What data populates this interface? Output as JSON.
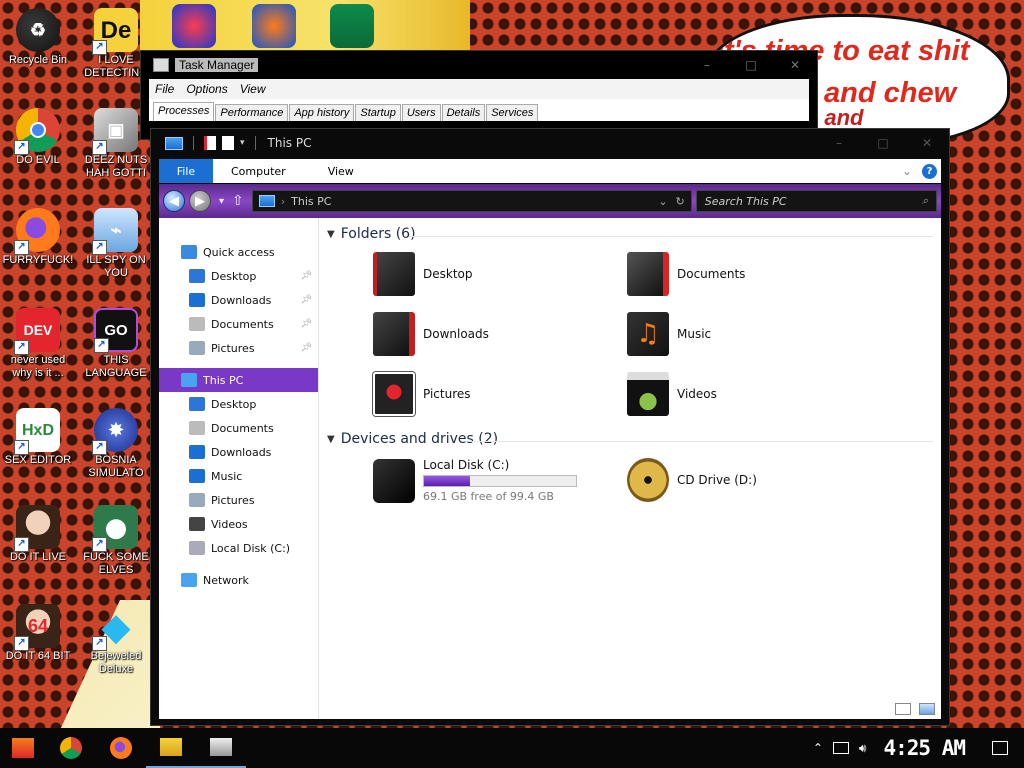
{
  "desktop": {
    "icons": [
      {
        "label": "Recycle Bin",
        "icon": "recycle-bin-icon"
      },
      {
        "label": "I LOVE DETECTING",
        "icon": "de-app-icon"
      },
      {
        "label": "DO EVIL",
        "icon": "chrome-icon"
      },
      {
        "label": "DEEZ NUTS HAH GOTTI",
        "icon": "windows-stack-icon"
      },
      {
        "label": "FURRYFUCK!",
        "icon": "firefox-icon"
      },
      {
        "label": "ILL SPY ON YOU",
        "icon": "network-spy-icon"
      },
      {
        "label": "never used why is it ...",
        "icon": "devcpp-icon"
      },
      {
        "label": "THIS LANGUAGE",
        "icon": "go-language-icon"
      },
      {
        "label": "SEX EDITOR",
        "icon": "hxd-editor-icon"
      },
      {
        "label": "BOSNIA SIMULATO",
        "icon": "bosnia-sim-icon"
      },
      {
        "label": "DO IT LIVE",
        "icon": "portrait-icon"
      },
      {
        "label": "FUCK SOME ELVES",
        "icon": "santa-icon"
      },
      {
        "label": "DO IT 64 BIT",
        "icon": "portrait-64-icon"
      },
      {
        "label": "Bejeweled Deluxe",
        "icon": "gem-icon"
      }
    ],
    "speech_lines": [
      "it's time to eat shit",
      "and chew",
      "s and"
    ]
  },
  "task_manager": {
    "title": "Task Manager",
    "menu": [
      "File",
      "Options",
      "View"
    ],
    "tabs": [
      "Processes",
      "Performance",
      "App history",
      "Startup",
      "Users",
      "Details",
      "Services"
    ],
    "active_tab": "Processes",
    "controls": [
      "–",
      "□",
      "✕"
    ]
  },
  "explorer": {
    "title": "This PC",
    "ribbon": {
      "file": "File",
      "tabs": [
        "Computer",
        "View"
      ],
      "help": "?",
      "expand": "⌄"
    },
    "address": {
      "path": "This PC",
      "search_placeholder": "Search This PC"
    },
    "nav": [
      {
        "label": "Quick access",
        "icon": "star-icon",
        "pinned": false,
        "indent": 0
      },
      {
        "label": "Desktop",
        "icon": "desktop-icon",
        "pinned": true,
        "indent": 1
      },
      {
        "label": "Downloads",
        "icon": "downloads-icon",
        "pinned": true,
        "indent": 1
      },
      {
        "label": "Documents",
        "icon": "documents-icon",
        "pinned": true,
        "indent": 1
      },
      {
        "label": "Pictures",
        "icon": "pictures-icon",
        "pinned": true,
        "indent": 1
      },
      {
        "label": "This PC",
        "icon": "pc-icon",
        "pinned": false,
        "indent": 0,
        "selected": true
      },
      {
        "label": "Desktop",
        "icon": "desktop-icon",
        "pinned": false,
        "indent": 1
      },
      {
        "label": "Documents",
        "icon": "documents-icon",
        "pinned": false,
        "indent": 1
      },
      {
        "label": "Downloads",
        "icon": "downloads-icon",
        "pinned": false,
        "indent": 1
      },
      {
        "label": "Music",
        "icon": "music-icon",
        "pinned": false,
        "indent": 1
      },
      {
        "label": "Pictures",
        "icon": "pictures-icon",
        "pinned": false,
        "indent": 1
      },
      {
        "label": "Videos",
        "icon": "videos-icon",
        "pinned": false,
        "indent": 1
      },
      {
        "label": "Local Disk (C:)",
        "icon": "disk-icon",
        "pinned": false,
        "indent": 1
      },
      {
        "label": "Network",
        "icon": "network-icon",
        "pinned": false,
        "indent": 0
      }
    ],
    "folders_header": "Folders (6)",
    "folders": [
      "Desktop",
      "Documents",
      "Downloads",
      "Music",
      "Pictures",
      "Videos"
    ],
    "devices_header": "Devices and drives (2)",
    "drives": [
      {
        "name": "Local Disk (C:)",
        "free_text": "69.1 GB free of 99.4 GB",
        "used_fraction": 0.305
      },
      {
        "name": "CD Drive (D:)"
      }
    ]
  },
  "taskbar": {
    "apps": [
      "start-icon",
      "chrome-icon",
      "firefox-icon",
      "file-explorer-icon",
      "task-manager-icon"
    ],
    "tray": {
      "chevron": "⌃",
      "clock": "4:25 AM"
    }
  },
  "colors": {
    "accent": "#7a38c6",
    "file_tab": "#1b6fd2",
    "drive_fill": "#5b1fb0"
  }
}
